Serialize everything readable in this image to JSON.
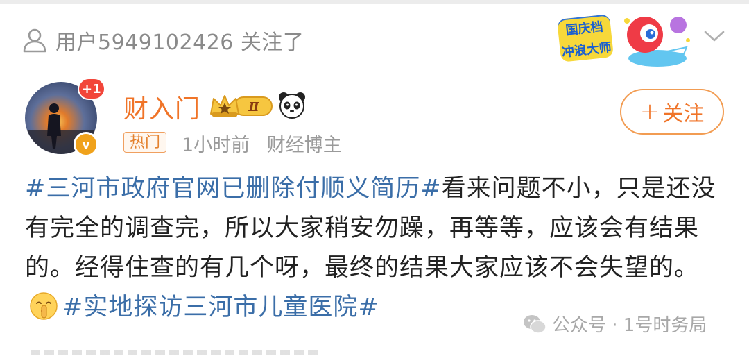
{
  "follow_notice": {
    "text": "用户5949102426 关注了"
  },
  "badge": {
    "line1": "国庆档",
    "line2": "冲浪大师"
  },
  "post": {
    "author": {
      "name": "财入门",
      "level": "Ⅱ",
      "notification_count": "+1",
      "verified": "v"
    },
    "hot_tag": "热门",
    "time": "1小时前",
    "role": "财经博主",
    "follow_button": {
      "plus": "+",
      "label": "关注"
    },
    "body": {
      "hashtag1": "#三河市政府官网已删除付顺义简历#",
      "text": "看来问题不小，只是还没有完全的调查完，所以大家稍安勿躁，再等等，应该会有结果的。经得住查的有几个呀，最终的结果大家应该不会失望的。",
      "hashtag2": "#实地探访三河市儿童医院#"
    }
  },
  "watermark": {
    "text": "公众号 · 1号时务局"
  },
  "icons": {
    "person": "person-icon",
    "chevron": "chevron-down-icon",
    "crown": "crown-level-icon",
    "panda": "panda-icon",
    "shush": "shushing-face-emoji",
    "wechat": "wechat-icon"
  },
  "colors": {
    "accent": "#f07428",
    "hashtag": "#3b6ea8",
    "muted": "#8a8a8a"
  }
}
